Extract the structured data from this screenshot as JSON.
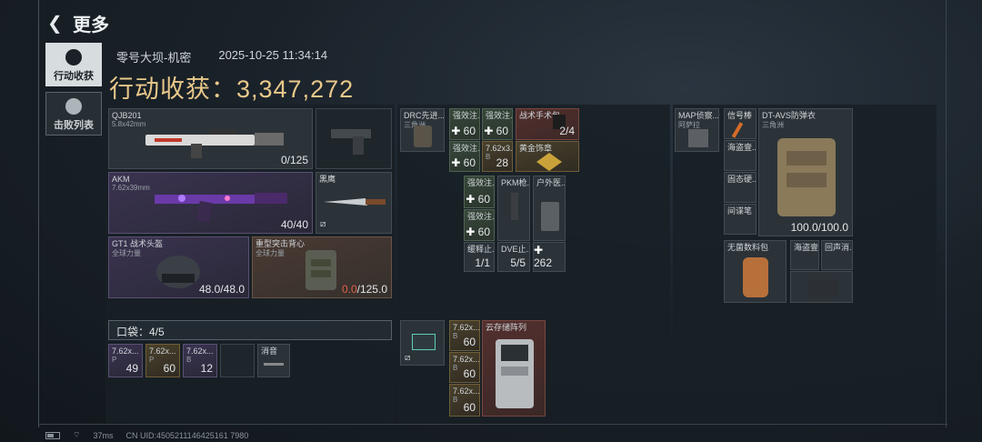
{
  "header": {
    "back_title": "更多"
  },
  "tabs": [
    {
      "label": "行动收获",
      "active": true
    },
    {
      "label": "击败列表",
      "active": false
    }
  ],
  "raid": {
    "map": "零号大坝-机密",
    "datetime": "2025-10-25 11:34:14"
  },
  "haul": {
    "label": "行动收获：",
    "value": "3,347,272"
  },
  "loadout": {
    "primary": {
      "name": "QJB201",
      "sub": "5.8x42mm",
      "value": "0/125"
    },
    "pistol": {
      "name": "",
      "value": ""
    },
    "secondary": {
      "name": "AKM",
      "sub": "7.62x39mm",
      "value": "40/40"
    },
    "melee": {
      "name": "黑鹰"
    },
    "helmet": {
      "name": "GT1 战术头盔",
      "sub": "全球力量",
      "value": "48.0/48.0"
    },
    "armor": {
      "name": "重型突击背心",
      "sub": "全球力量",
      "value_red": "0.0",
      "value_rest": "/125.0"
    }
  },
  "pockets": {
    "label": "口袋：4/5",
    "items": [
      {
        "name": "7.62x...",
        "sub": "P",
        "value": "49"
      },
      {
        "name": "7.62x...",
        "sub": "P",
        "value": "60"
      },
      {
        "name": "7.62x...",
        "sub": "B",
        "value": "12"
      },
      {
        "name": "",
        "sub": "",
        "value": ""
      },
      {
        "name": "消音",
        "sub": "",
        "value": ""
      }
    ]
  },
  "chest_rig": {
    "rig": {
      "name": "DRC先进...",
      "sub": "三角洲"
    },
    "items": [
      {
        "name": "强效注...",
        "value": "60"
      },
      {
        "name": "强效注...",
        "value": "60"
      },
      {
        "name": "战术手术包",
        "value": "2/4"
      },
      {
        "name": "强效注...",
        "value": "60"
      },
      {
        "name": "7.62x3...",
        "sub": "B",
        "value": "28"
      },
      {
        "name": "黄金饰章",
        "value": ""
      }
    ]
  },
  "chest_rig_2": {
    "items": [
      {
        "name": "强效注...",
        "value": "60"
      },
      {
        "name": "PKM枪...",
        "value": ""
      },
      {
        "name": "户外医...",
        "value": ""
      },
      {
        "name": "强效注...",
        "value": "60"
      },
      {
        "name": "缓释止...",
        "value": "1/1"
      },
      {
        "name": "DVE止...",
        "value": "5/5"
      },
      {
        "name": "",
        "value": "262"
      }
    ]
  },
  "backpack": {
    "items": [
      {
        "name": "7.62x...",
        "sub": "B",
        "value": "60"
      },
      {
        "name": "云存储阵列"
      },
      {
        "name": "7.62x...",
        "sub": "B",
        "value": "60"
      },
      {
        "name": "7.62x...",
        "sub": "B",
        "value": "60"
      }
    ]
  },
  "safe_box": {
    "map": {
      "name": "MAP侦察...",
      "sub": "阿萨拉"
    },
    "flare": {
      "name": "信号棒"
    },
    "item2": {
      "name": "海盗壹..."
    },
    "item3": {
      "name": "固态硬..."
    },
    "item4": {
      "name": "间谍笔"
    },
    "armor": {
      "name": "DT-AVS防弹衣",
      "sub": "三角洲",
      "value": "100.0/100.0"
    },
    "lamp": {
      "name": "无菌数料包"
    },
    "pirate": {
      "name": "海盗壹..."
    },
    "silencer": {
      "name": "回声消..."
    }
  },
  "footer": {
    "ping": "37ms",
    "uid": "CN UID:4505211146425161 7980"
  },
  "colors": {
    "accent": "#e9c88a",
    "danger": "#e0604c"
  }
}
